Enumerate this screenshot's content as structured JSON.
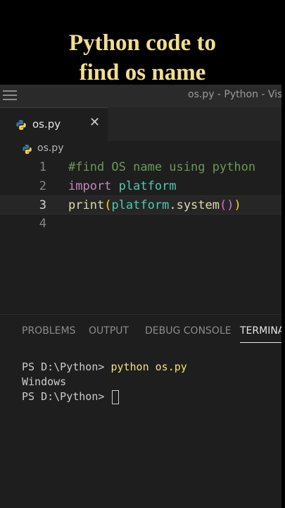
{
  "caption": {
    "line1": "Python code to",
    "line2": "find os name"
  },
  "window": {
    "title": "os.py - Python - Visu"
  },
  "tab": {
    "label": "os.py",
    "close_glyph": "✕"
  },
  "breadcrumb": {
    "label": "os.py"
  },
  "editor": {
    "line_numbers": [
      "1",
      "2",
      "3",
      "4"
    ],
    "line1": {
      "comment": "#find OS name using python"
    },
    "line2": {
      "keyword": "import",
      "module": "platform"
    },
    "line3": {
      "func": "print",
      "paren_open": "(",
      "module": "platform",
      "dot": ".",
      "method": "system",
      "inner_parens": "()",
      "paren_close": ")"
    },
    "current_line": "3"
  },
  "panel": {
    "tabs": [
      "PROBLEMS",
      "OUTPUT",
      "DEBUG CONSOLE",
      "TERMINAL"
    ],
    "active_tab": "TERMINAL"
  },
  "terminal": {
    "prompt1": "PS D:\\Python> ",
    "command": "python os.py",
    "output": "Windows",
    "prompt2": "PS D:\\Python> "
  },
  "colors": {
    "caption": "#f2de8f",
    "comment": "#6a9955",
    "keyword": "#c586c0",
    "module": "#4ec9b0",
    "function": "#dcdcaa",
    "bracket_outer": "#ffd700",
    "bracket_inner": "#da70d6",
    "python_icon_blue": "#3776ab",
    "python_icon_yellow": "#ffd43b"
  },
  "icons": {
    "menu": "hamburger-menu-icon",
    "file": "python-file-icon",
    "close": "close-icon"
  }
}
